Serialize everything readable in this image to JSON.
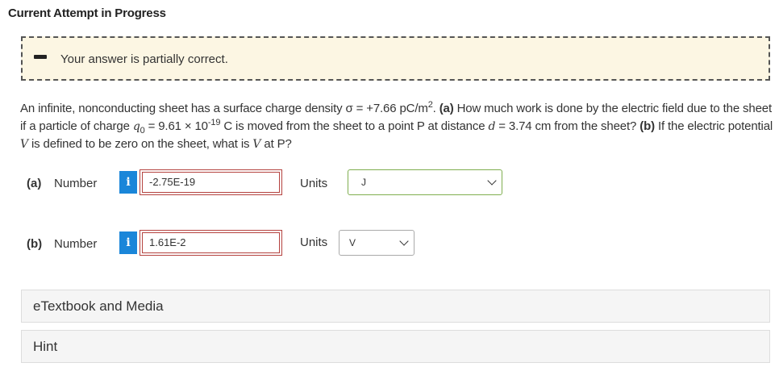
{
  "header": {
    "title": "Current Attempt in Progress"
  },
  "feedback": {
    "icon": "minus-icon",
    "message": "Your answer is partially correct."
  },
  "question": {
    "part1": "An infinite, nonconducting sheet has a surface charge density σ = +7.66 pC/m",
    "sup1": "2",
    "part2": ". ",
    "label_a": "(a)",
    "part3": " How much work is done by the electric field due to the sheet if a particle of charge ",
    "var_q": "q",
    "sub_q": "0",
    "part4": " = 9.61 × 10",
    "sup2": "-19",
    "part5": " C is moved from the sheet to a point P at distance ",
    "var_d": "d",
    "part6": " = 3.74 cm from the sheet? ",
    "label_b": "(b)",
    "part7": " If the electric potential ",
    "var_v": "V",
    "part8": " is defined to be zero on the sheet, what is ",
    "var_v2": "V",
    "part9": " at P?"
  },
  "answers": [
    {
      "part_label": "(a)",
      "number_label": "Number",
      "info_icon": "i",
      "value": "-2.75E-19",
      "units_label": "Units",
      "units_value": "J",
      "status": "incorrect"
    },
    {
      "part_label": "(b)",
      "number_label": "Number",
      "info_icon": "i",
      "value": "1.61E-2",
      "units_label": "Units",
      "units_value": "V",
      "status": "incorrect"
    }
  ],
  "panels": {
    "etextbook": "eTextbook and Media",
    "hint": "Hint"
  },
  "colors": {
    "feedback_bg": "#fcf6e3",
    "info_blue": "#1a86d9",
    "incorrect_border": "#b4423f",
    "units_correct_border": "#7fae4f"
  }
}
